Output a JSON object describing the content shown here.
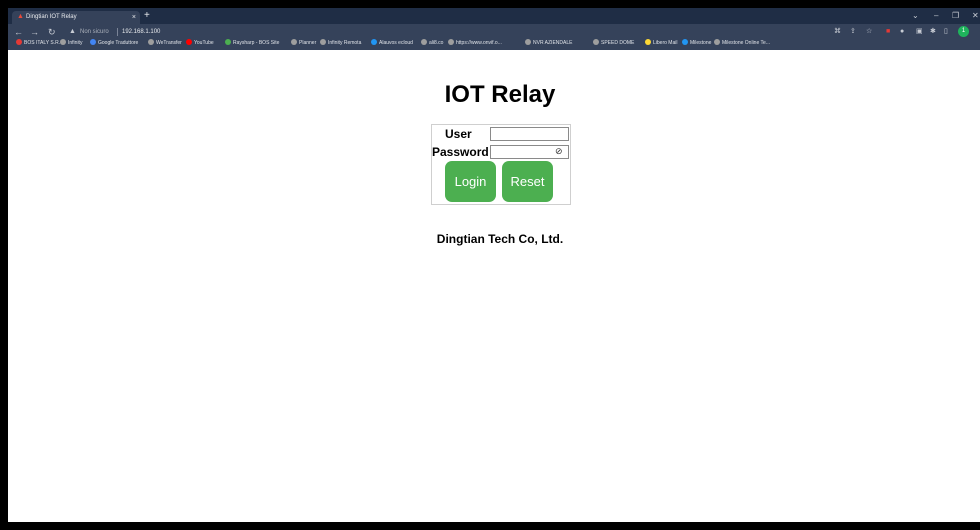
{
  "browser": {
    "tab_title": "Dingtian IOT Relay",
    "tab_close": "×",
    "new_tab": "+",
    "address_warning": "Non sicuro",
    "url": "192.168.1.100",
    "bookmarks": [
      {
        "label": "BOS ITALY S.R.L.",
        "color": "#e53935"
      },
      {
        "label": "Infinity",
        "color": "#9e9e9e"
      },
      {
        "label": "Google Traduttore",
        "color": "#4285f4"
      },
      {
        "label": "WeTransfer",
        "color": "#9e9e9e"
      },
      {
        "label": "YouTube",
        "color": "#ff0000"
      },
      {
        "label": "Raysharp - BOS Site",
        "color": "#4caf50"
      },
      {
        "label": "Planner",
        "color": "#9e9e9e"
      },
      {
        "label": "Infinity Remota",
        "color": "#9e9e9e"
      },
      {
        "label": "Alauvos ecloud",
        "color": "#2196f3"
      },
      {
        "label": "ali8.co",
        "color": "#9e9e9e"
      },
      {
        "label": "https://www.onvif.o...",
        "color": "#9e9e9e"
      },
      {
        "label": "NVR AZIENDALE",
        "color": "#9e9e9e"
      },
      {
        "label": "SPEED DOME",
        "color": "#9e9e9e"
      },
      {
        "label": "Libero Mail",
        "color": "#fdd835"
      },
      {
        "label": "Milestone",
        "color": "#2196f3"
      },
      {
        "label": "Milestone Online Te...",
        "color": "#9e9e9e"
      }
    ],
    "profile_initial": "1"
  },
  "page": {
    "title": "IOT Relay",
    "user_label": "User",
    "password_label": "Password",
    "user_value": "",
    "password_value": "",
    "login_button": "Login",
    "reset_button": "Reset",
    "company": "Dingtian Tech Co, Ltd."
  }
}
